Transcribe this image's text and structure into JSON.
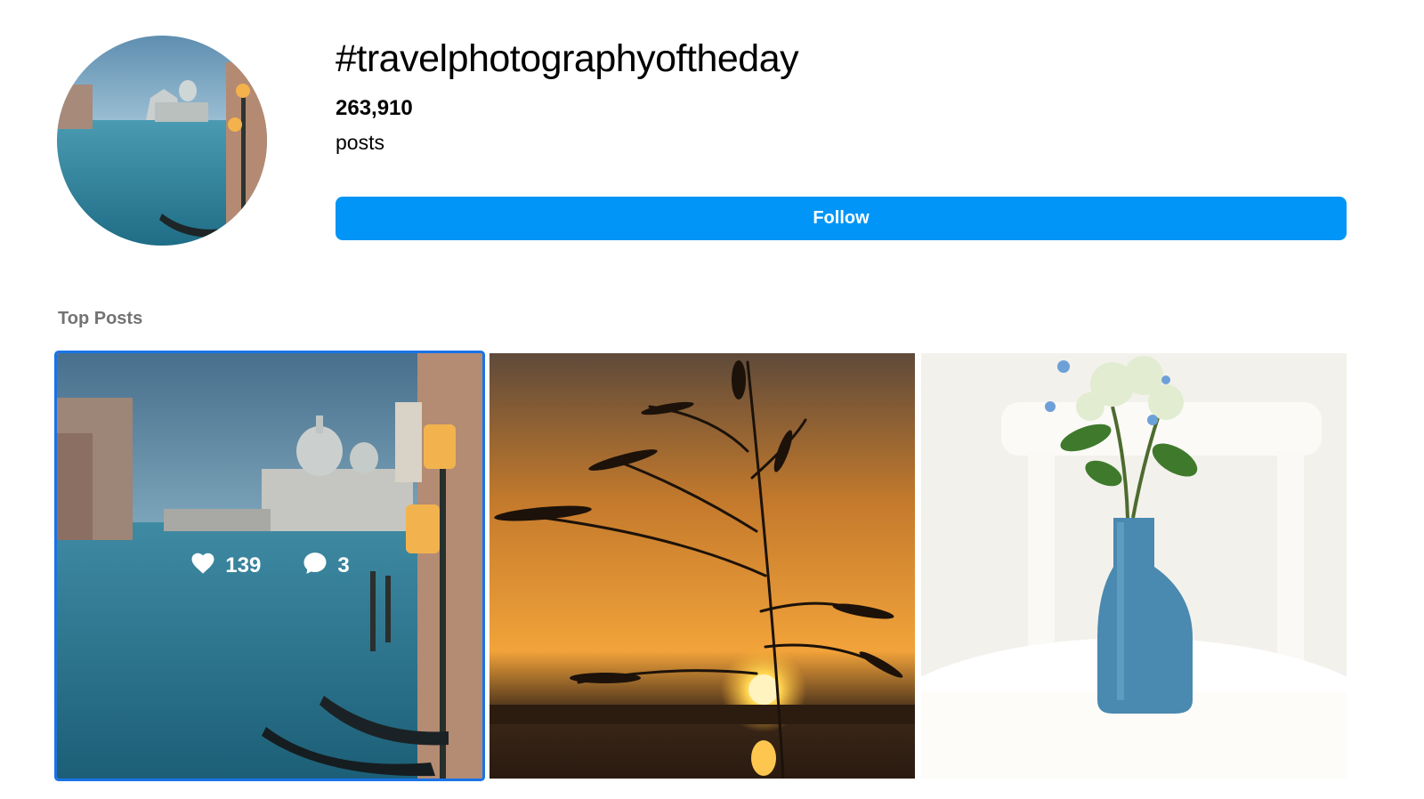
{
  "header": {
    "hashtag": "#travelphotographyoftheday",
    "post_count": "263,910",
    "post_count_label": "posts",
    "follow_label": "Follow"
  },
  "top_posts": {
    "title": "Top Posts",
    "posts": [
      {
        "scene": "venice-canal",
        "likes": "139",
        "comments": "3",
        "hovered": true
      },
      {
        "scene": "sunset-grass"
      },
      {
        "scene": "blue-vase-flowers"
      }
    ]
  },
  "colors": {
    "accent": "#0095f6",
    "section_title": "#737373",
    "selection_outline": "#1a73e8"
  },
  "icons": [
    "heart-icon",
    "comment-icon"
  ]
}
